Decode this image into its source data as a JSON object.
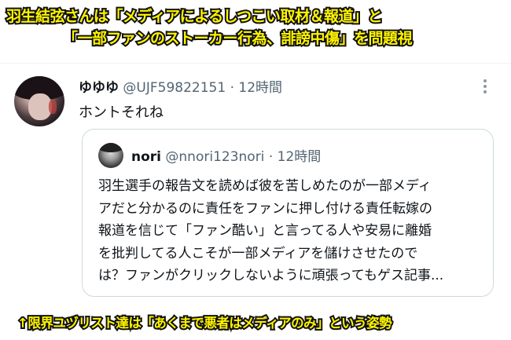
{
  "captions": {
    "line1": "羽生結弦さんは「メディアによるしつこい取材＆報道」と",
    "line2": "「一部ファンのストーカー行為、誹謗中傷」を問題視",
    "bottom": "↑限界ユヅリスト達は「あくまで悪者はメディアのみ」という姿勢"
  },
  "tweet": {
    "display_name": "ゆゆゆ",
    "handle": "@UJF59822151",
    "separator": "·",
    "time": "12時間",
    "text": "ホントそれね",
    "avatar_icon": "user-avatar-photo",
    "more_icon": "more-vertical-icon"
  },
  "quote": {
    "display_name": "nori",
    "handle": "@nnori123nori",
    "separator": "·",
    "time": "12時間",
    "lines": [
      "羽生選手の報告文を読めば彼を苦しめたのが一部メディ",
      "アだと分かるのに責任をファンに押し付ける責任転嫁の",
      "報道を信じて「ファン酷い」と言ってる人や安易に離婚",
      "を批判してる人こそが一部メディアを儲けさせたので",
      "は？ファンがクリックしないように頑張ってもゲス記事..."
    ],
    "avatar_icon": "user-avatar-photo"
  },
  "colors": {
    "caption_fill": "#fff400",
    "caption_stroke": "#111111",
    "text_primary": "#0f1419",
    "text_secondary": "#536471",
    "card_border": "#cfd9de"
  }
}
